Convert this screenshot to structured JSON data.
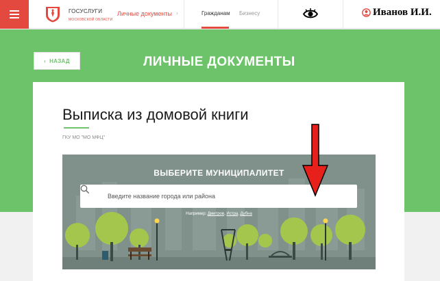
{
  "header": {
    "brand_title": "ГОСУСЛУГИ",
    "brand_subtitle": "МОСКОВСКОЙ ОБЛАСТИ",
    "section_link": "Личные документы",
    "nav_citizens": "Гражданам",
    "nav_business": "Бизнесу",
    "user_name": "Иванов И.И."
  },
  "page": {
    "back_label": "НАЗАД",
    "heading": "ЛИЧНЫЕ ДОКУМЕНТЫ"
  },
  "service": {
    "title": "Выписка из домовой книги",
    "org": "ГКУ МО \"МО МФЦ\""
  },
  "municipality": {
    "title": "ВЫБЕРИТЕ МУНИЦИПАЛИТЕТ",
    "search_placeholder": "Введите название города или района",
    "examples_prefix": "Например:",
    "examples": [
      "Дмитров",
      "Истра",
      "Дубна"
    ]
  },
  "colors": {
    "accent_red": "#e3493f",
    "brand_green": "#6dc36a",
    "annotation_arrow": "#e8201b"
  }
}
